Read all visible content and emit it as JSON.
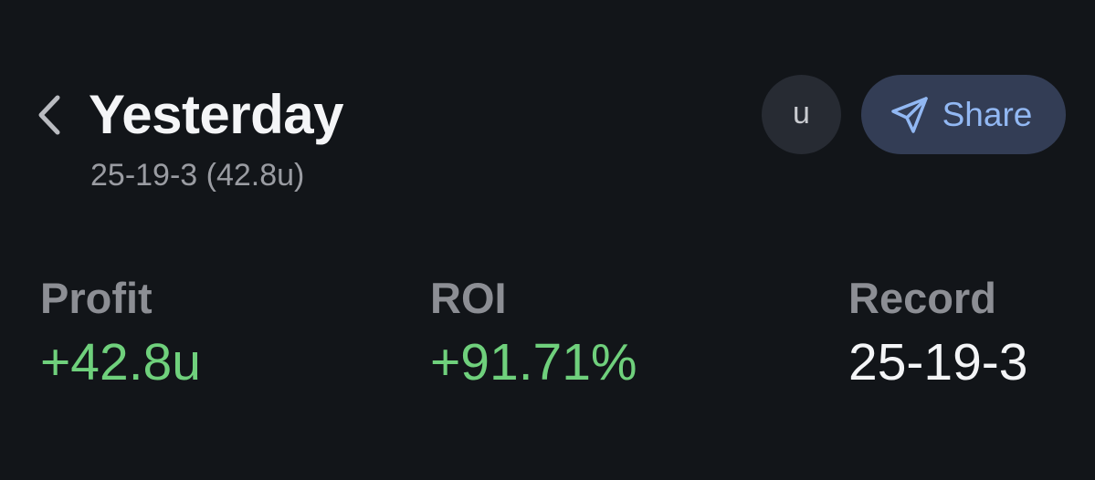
{
  "header": {
    "back_icon": "chevron-left-icon",
    "title": "Yesterday",
    "subtitle": "25-19-3 (42.8u)",
    "unit_button_label": "u",
    "share_button": {
      "icon": "paper-plane-icon",
      "label": "Share"
    }
  },
  "stats": {
    "profit": {
      "label": "Profit",
      "value": "+42.8u"
    },
    "roi": {
      "label": "ROI",
      "value": "+91.71%"
    },
    "record": {
      "label": "Record",
      "value": "25-19-3"
    }
  },
  "colors": {
    "background": "#121519",
    "positive": "#6fd07c",
    "share_bg": "#333d55",
    "share_text": "#92b8f3",
    "muted": "#8c8e94"
  }
}
